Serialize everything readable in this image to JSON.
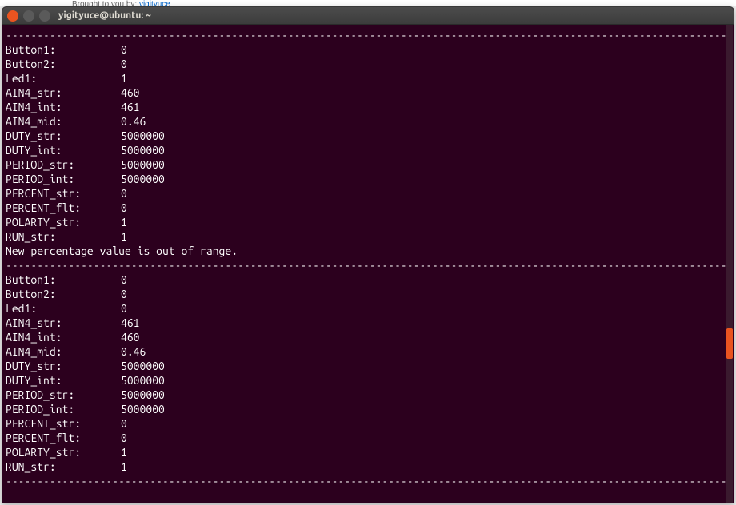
{
  "browser_hint_prefix": "Brought to you by: ",
  "browser_hint_link": "vigityuce",
  "window": {
    "title": "yigityuce@ubuntu: ~"
  },
  "dashes": "---------------------------------------------------------------------------------------------------------------------------------",
  "block1": [
    {
      "label": "Button1:",
      "value": "0"
    },
    {
      "label": "Button2:",
      "value": "0"
    },
    {
      "label": "Led1:",
      "value": "1"
    },
    {
      "label": "AIN4_str:",
      "value": "460"
    },
    {
      "label": "AIN4_int:",
      "value": "461"
    },
    {
      "label": "AIN4_mid:",
      "value": "0.46"
    },
    {
      "label": "DUTY_str:",
      "value": "5000000"
    },
    {
      "label": "DUTY_int:",
      "value": "5000000"
    },
    {
      "label": "PERIOD_str:",
      "value": "5000000"
    },
    {
      "label": "PERIOD_int:",
      "value": "5000000"
    },
    {
      "label": "PERCENT_str:",
      "value": "0"
    },
    {
      "label": "PERCENT_flt:",
      "value": "0"
    },
    {
      "label": "POLARTY_str:",
      "value": "1"
    },
    {
      "label": "RUN_str:",
      "value": "1"
    }
  ],
  "message": "New percentage value is out of range.",
  "block2": [
    {
      "label": "Button1:",
      "value": "0"
    },
    {
      "label": "Button2:",
      "value": "0"
    },
    {
      "label": "Led1:",
      "value": "0"
    },
    {
      "label": "AIN4_str:",
      "value": "461"
    },
    {
      "label": "AIN4_int:",
      "value": "460"
    },
    {
      "label": "AIN4_mid:",
      "value": "0.46"
    },
    {
      "label": "DUTY_str:",
      "value": "5000000"
    },
    {
      "label": "DUTY_int:",
      "value": "5000000"
    },
    {
      "label": "PERIOD_str:",
      "value": "5000000"
    },
    {
      "label": "PERIOD_int:",
      "value": "5000000"
    },
    {
      "label": "PERCENT_str:",
      "value": "0"
    },
    {
      "label": "PERCENT_flt:",
      "value": "0"
    },
    {
      "label": "POLARTY_str:",
      "value": "1"
    },
    {
      "label": "RUN_str:",
      "value": "1"
    }
  ]
}
